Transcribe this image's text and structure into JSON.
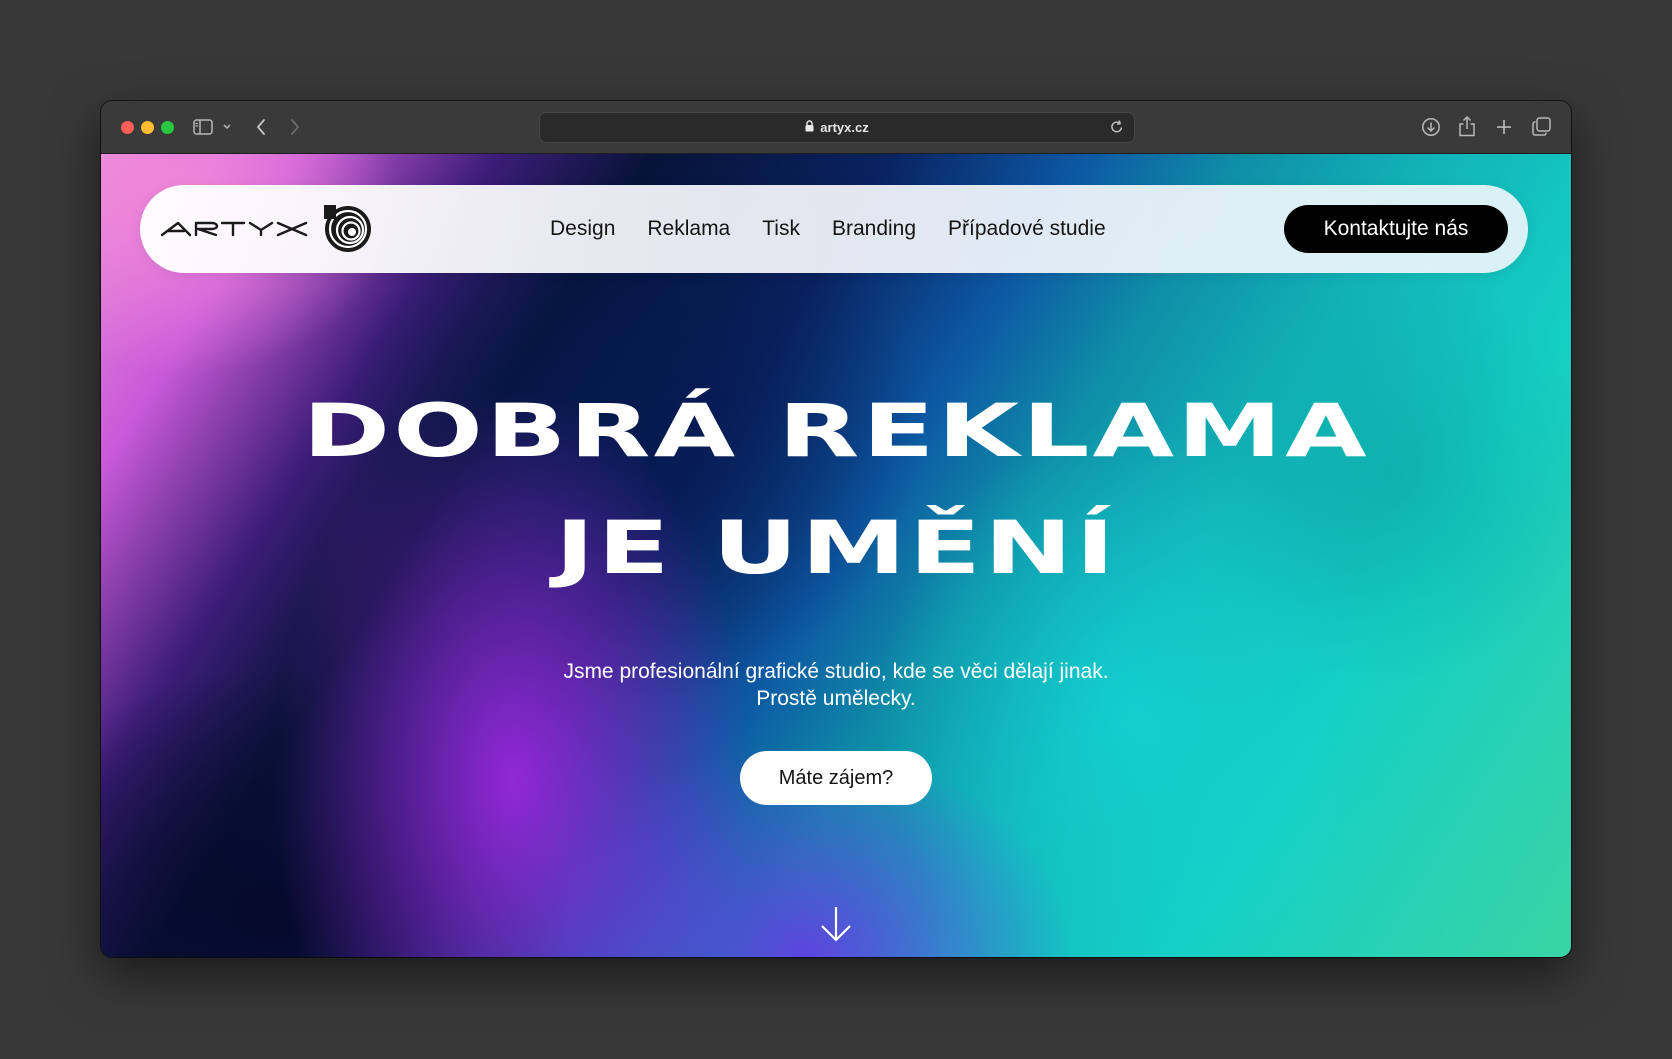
{
  "browser": {
    "url": "artyx.cz",
    "icons": [
      "sidebar-icon",
      "chevron-down-icon",
      "back-icon",
      "forward-icon",
      "lock-icon",
      "reload-icon",
      "download-icon",
      "share-icon",
      "new-tab-icon",
      "tabs-overview-icon"
    ]
  },
  "nav": {
    "logo_text": "ARTYX",
    "links": [
      "Design",
      "Reklama",
      "Tisk",
      "Branding",
      "Případové studie"
    ],
    "cta_label": "Kontaktujte nás"
  },
  "hero": {
    "title_line1": "DOBRÁ REKLAMA",
    "title_line2": "JE UMĚNÍ",
    "subtitle_line1": "Jsme profesionální grafické studio, kde se věci dělají jinak.",
    "subtitle_line2": "Prostě umělecky.",
    "button_label": "Máte zájem?",
    "scroll_icon": "arrow-down-icon"
  },
  "colors": {
    "cta_bg": "#000000",
    "gradient_pink": "#ea8ad8",
    "gradient_purple": "#a82ceb",
    "gradient_navy": "#071338",
    "gradient_teal": "#15cfc4"
  }
}
